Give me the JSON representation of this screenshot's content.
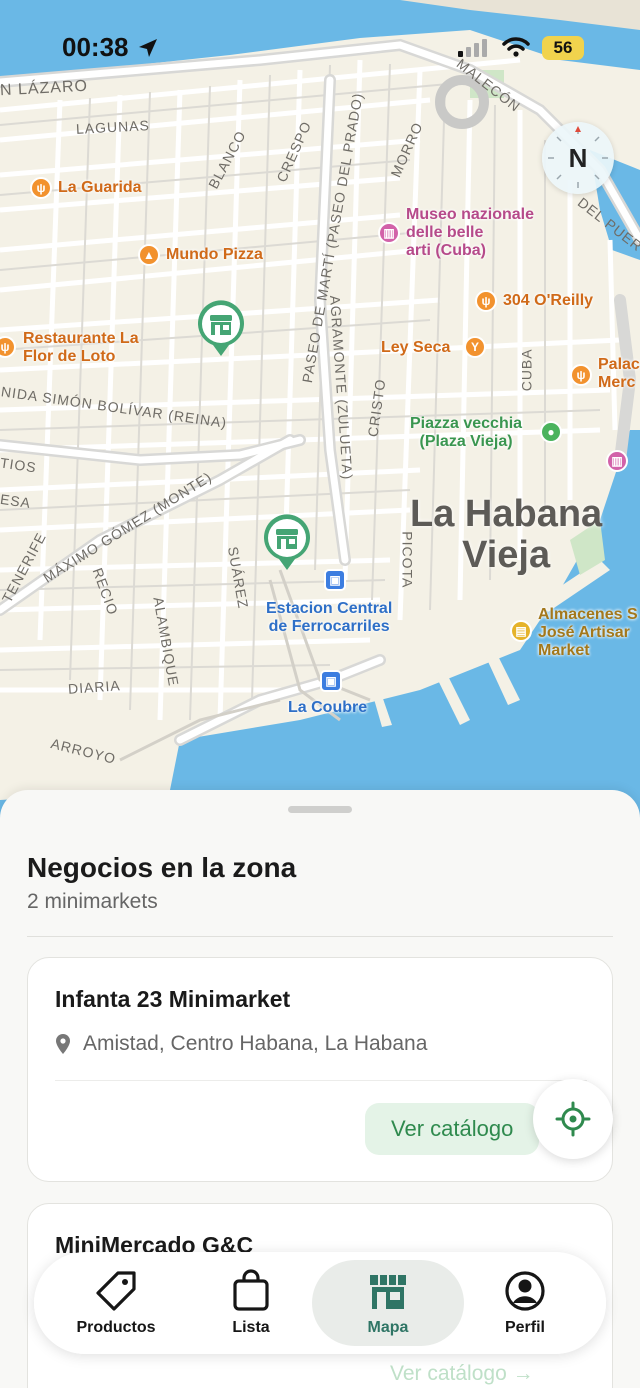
{
  "status_bar": {
    "time": "00:38",
    "battery": "56"
  },
  "map": {
    "compass": "N",
    "streets": [
      "N LÁZARO",
      "LAGUNAS",
      "BLANCO",
      "CRESPO",
      "MORRO",
      "MALECÓN",
      "DEL PUERT",
      "PASEO DE MARTÍ (PASEO DEL PRADO)",
      "AGRAMONTE (ZULUETA)",
      "NIDA SIMÓN BOLÍVAR (REINA)",
      "MÁXIMO GÓMEZ (MONTE)",
      "CRISTO",
      "CUBA",
      "PICOTA",
      "SUÁREZ",
      "RECIO",
      "ALAMBIQUE",
      "DIARIA",
      "ARROYO",
      "TENERIFE",
      "TIOS",
      "ESA"
    ],
    "pois": {
      "la_guarida": "La Guarida",
      "mundo_pizza": "Mundo Pizza",
      "restaurante_1": "Restaurante La",
      "restaurante_2": "Flor de Loto",
      "museo_1": "Museo nazionale",
      "museo_2": "delle belle",
      "museo_3": "arti (Cuba)",
      "oreilly": "304 O'Reilly",
      "ley_seca": "Ley Seca",
      "palac_1": "Palac",
      "palac_2": "Merc",
      "piazza_1": "Piazza vecchia",
      "piazza_2": "(Plaza Vieja)",
      "estacion_1": "Estacion Central",
      "estacion_2": "de Ferrocarriles",
      "la_coubre": "La Coubre",
      "almacenes_1": "Almacenes S",
      "almacenes_2": "José Artisar",
      "almacenes_3": "Market"
    },
    "district_1": "La Habana",
    "district_2": "Vieja"
  },
  "sheet": {
    "title": "Negocios en la zona",
    "subtitle": "2 minimarkets",
    "cards": [
      {
        "name": "Infanta 23 Minimarket",
        "address": "Amistad, Centro Habana, La Habana",
        "button": "Ver catálogo"
      },
      {
        "name": "MiniMercado G&C",
        "button": "Ver catálogo →"
      }
    ]
  },
  "tabbar": {
    "items": [
      {
        "label": "Productos",
        "icon": "tag-icon"
      },
      {
        "label": "Lista",
        "icon": "bag-icon"
      },
      {
        "label": "Mapa",
        "icon": "store-icon",
        "active": true
      },
      {
        "label": "Perfil",
        "icon": "user-circle-icon"
      }
    ]
  },
  "colors": {
    "accent": "#2f7565",
    "water": "#6ab8e6",
    "land": "#f4f1e6",
    "button_bg": "#e4f3e7"
  }
}
